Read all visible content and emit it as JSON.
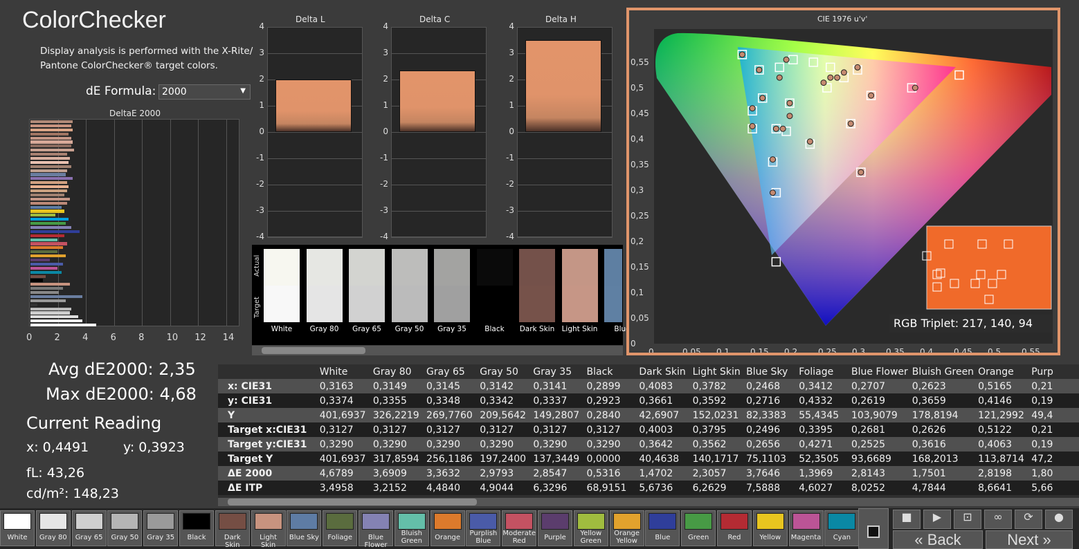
{
  "title": "ColorChecker",
  "description": "Display analysis is performed with the X-Rite/ Pantone ColorChecker® target colors.",
  "de_formula_label": "dE Formula:",
  "de_formula_value": "2000",
  "deltae_chart_title": "DeltaE 2000",
  "deltae_x_ticks": [
    "0",
    "2",
    "4",
    "6",
    "8",
    "10",
    "12",
    "14"
  ],
  "delta_charts": [
    {
      "title": "Delta L",
      "value": 2.0
    },
    {
      "title": "Delta C",
      "value": 2.35
    },
    {
      "title": "Delta H",
      "value": 3.5
    }
  ],
  "delta_ticks": [
    "4",
    "3",
    "2",
    "1",
    "0",
    "-1",
    "-2",
    "-3",
    "-4"
  ],
  "swatch_labels": {
    "actual": "Actual",
    "target": "Target"
  },
  "swatches": [
    {
      "name": "White",
      "actual": "#f7f7f0",
      "target": "#f8f8f8"
    },
    {
      "name": "Gray 80",
      "actual": "#e6e7e3",
      "target": "#e5e5e5"
    },
    {
      "name": "Gray 65",
      "actual": "#d3d4d0",
      "target": "#d1d1d1"
    },
    {
      "name": "Gray 50",
      "actual": "#bdbdbb",
      "target": "#bbbbbb"
    },
    {
      "name": "Gray 35",
      "actual": "#a3a3a1",
      "target": "#a0a0a0"
    },
    {
      "name": "Black",
      "actual": "#0a0a0a",
      "target": "#000000"
    },
    {
      "name": "Dark Skin",
      "actual": "#74514a",
      "target": "#76524a"
    },
    {
      "name": "Light Skin",
      "actual": "#c49686",
      "target": "#c69686"
    },
    {
      "name": "Blue",
      "actual": "#5e7fa2",
      "target": "#5f80a3"
    }
  ],
  "summary": {
    "avg": "Avg dE2000: 2,35",
    "max": "Max dE2000: 4,68"
  },
  "current_reading": {
    "title": "Current Reading",
    "x": "x: 0,4491",
    "y": "y: 0,3923",
    "fl": "fL: 43,26",
    "cdm2": "cd/m²: 148,23"
  },
  "cie": {
    "title": "CIE 1976 u'v'",
    "rgb_triplet": "RGB Triplet: 217, 140, 94",
    "y_ticks": [
      "0,55",
      "0,5",
      "0,45",
      "0,4",
      "0,35",
      "0,3",
      "0,25",
      "0,2",
      "0,15",
      "0,1",
      "0,05",
      "0"
    ],
    "x_ticks": [
      "0",
      "0,05",
      "0,1",
      "0,15",
      "0,2",
      "0,25",
      "0,3",
      "0,35",
      "0,4",
      "0,45",
      "0,5",
      "0,55"
    ]
  },
  "table": {
    "columns": [
      "White",
      "Gray 80",
      "Gray 65",
      "Gray 50",
      "Gray 35",
      "Black",
      "Dark Skin",
      "Light Skin",
      "Blue Sky",
      "Foliage",
      "Blue Flower",
      "Bluish Green",
      "Orange",
      "Purp"
    ],
    "rows": [
      {
        "label": "x: CIE31",
        "values": [
          "0,3163",
          "0,3149",
          "0,3145",
          "0,3142",
          "0,3141",
          "0,2899",
          "0,4083",
          "0,3782",
          "0,2468",
          "0,3412",
          "0,2707",
          "0,2623",
          "0,5165",
          "0,21"
        ]
      },
      {
        "label": "y: CIE31",
        "values": [
          "0,3374",
          "0,3355",
          "0,3348",
          "0,3342",
          "0,3337",
          "0,2923",
          "0,3661",
          "0,3592",
          "0,2716",
          "0,4332",
          "0,2619",
          "0,3659",
          "0,4146",
          "0,19"
        ]
      },
      {
        "label": "Y",
        "values": [
          "401,6937",
          "326,2219",
          "269,7760",
          "209,5642",
          "149,2807",
          "0,2840",
          "42,6907",
          "152,0231",
          "82,3383",
          "55,4345",
          "103,9079",
          "178,8194",
          "121,2992",
          "49,4"
        ]
      },
      {
        "label": "Target x:CIE31",
        "values": [
          "0,3127",
          "0,3127",
          "0,3127",
          "0,3127",
          "0,3127",
          "0,3127",
          "0,4003",
          "0,3795",
          "0,2496",
          "0,3395",
          "0,2681",
          "0,2626",
          "0,5122",
          "0,21"
        ]
      },
      {
        "label": "Target y:CIE31",
        "values": [
          "0,3290",
          "0,3290",
          "0,3290",
          "0,3290",
          "0,3290",
          "0,3290",
          "0,3642",
          "0,3562",
          "0,2656",
          "0,4271",
          "0,2525",
          "0,3616",
          "0,4063",
          "0,19"
        ]
      },
      {
        "label": "Target Y",
        "values": [
          "401,6937",
          "317,8594",
          "256,1186",
          "197,2400",
          "137,3449",
          "0,0000",
          "40,4638",
          "140,1717",
          "75,1103",
          "52,3505",
          "93,6689",
          "168,2013",
          "113,8714",
          "47,2"
        ]
      },
      {
        "label": "ΔE 2000",
        "values": [
          "4,6789",
          "3,6909",
          "3,3632",
          "2,9793",
          "2,8547",
          "0,5316",
          "1,4702",
          "2,3057",
          "3,7646",
          "1,3969",
          "2,8143",
          "1,7501",
          "2,8198",
          "1,80"
        ]
      },
      {
        "label": "ΔE ITP",
        "values": [
          "3,4958",
          "3,2152",
          "4,4840",
          "4,9044",
          "6,3296",
          "68,9151",
          "5,6736",
          "6,2629",
          "7,5888",
          "4,6027",
          "8,0252",
          "4,7844",
          "8,6641",
          "5,66"
        ]
      }
    ]
  },
  "patches": [
    {
      "label": "White",
      "color": "#ffffff"
    },
    {
      "label": "Gray 80",
      "color": "#e6e6e6"
    },
    {
      "label": "Gray 65",
      "color": "#cfcfcf"
    },
    {
      "label": "Gray 50",
      "color": "#b5b5b5"
    },
    {
      "label": "Gray 35",
      "color": "#9a9a9a"
    },
    {
      "label": "Black",
      "color": "#000000"
    },
    {
      "label": "Dark Skin",
      "color": "#754e44"
    },
    {
      "label": "Light Skin",
      "color": "#c7937f"
    },
    {
      "label": "Blue Sky",
      "color": "#5e7ca4"
    },
    {
      "label": "Foliage",
      "color": "#5a6c3e"
    },
    {
      "label": "Blue Flower",
      "color": "#8482b3"
    },
    {
      "label": "Bluish Green",
      "color": "#64bfa9"
    },
    {
      "label": "Orange",
      "color": "#dc7a2c"
    },
    {
      "label": "Purplish Blue",
      "color": "#4a5ba8"
    },
    {
      "label": "Moderate Red",
      "color": "#c45262"
    },
    {
      "label": "Purple",
      "color": "#5b3d6d"
    },
    {
      "label": "Yellow Green",
      "color": "#a0bc3f"
    },
    {
      "label": "Orange Yellow",
      "color": "#e2a22d"
    },
    {
      "label": "Blue",
      "color": "#2f3e9a"
    },
    {
      "label": "Green",
      "color": "#479a45"
    },
    {
      "label": "Red",
      "color": "#b42b33"
    },
    {
      "label": "Yellow",
      "color": "#e8c51f"
    },
    {
      "label": "Magenta",
      "color": "#bb5496"
    },
    {
      "label": "Cyan",
      "color": "#0a88a4"
    }
  ],
  "nav": {
    "back": "Back",
    "next": "Next"
  },
  "colors": {
    "accent": "#e0956b",
    "bar": "#e2946a"
  }
}
